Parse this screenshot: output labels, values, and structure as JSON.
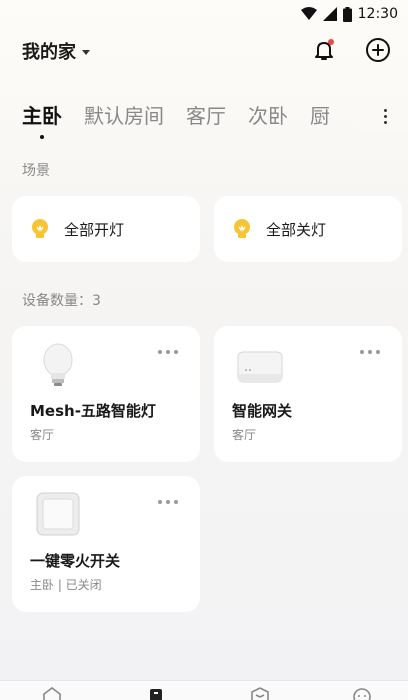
{
  "status_bar": {
    "time": "12:30"
  },
  "header": {
    "home_name": "我的家"
  },
  "tabs": [
    {
      "label": "主卧",
      "active": true
    },
    {
      "label": "默认房间"
    },
    {
      "label": "客厅"
    },
    {
      "label": "次卧"
    },
    {
      "label": "厨"
    }
  ],
  "scenes": {
    "title": "场景",
    "items": [
      {
        "label": "全部开灯",
        "icon": "bulb-icon"
      },
      {
        "label": "全部关灯",
        "icon": "bulb-icon"
      }
    ]
  },
  "devices": {
    "count_label": "设备数量：3",
    "items": [
      {
        "name": "Mesh-五路智能灯",
        "sub": "客厅",
        "icon": "light-bulb-icon"
      },
      {
        "name": "智能网关",
        "sub": "客厅",
        "icon": "gateway-icon"
      },
      {
        "name": "一键零火开关",
        "sub": "主卧 | 已关闭",
        "icon": "wall-switch-icon"
      }
    ]
  },
  "colors": {
    "accent_yellow": "#f7c433",
    "notification_dot": "#e9493f"
  }
}
